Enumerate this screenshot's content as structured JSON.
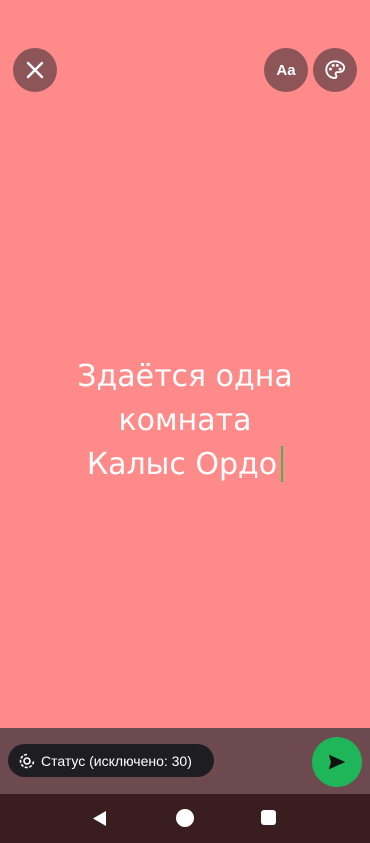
{
  "toolbar": {
    "close_icon": "close-icon",
    "font_label": "Aa",
    "palette_icon": "palette-icon"
  },
  "status": {
    "lines": [
      "Здаётся одна",
      "комната",
      "Калыс Ордо"
    ],
    "text_color": "#ffffff",
    "background_color": "#ff8a8a",
    "caret_color": "#4caf50"
  },
  "composer": {
    "audience_label": "Статус (исключено: 30)",
    "audience_icon": "status-ring-icon",
    "send_icon": "send-icon",
    "send_color": "#1fb65a"
  },
  "navigation": {
    "back_icon": "back-triangle-icon",
    "home_icon": "home-circle-icon",
    "recents_icon": "recents-square-icon"
  }
}
